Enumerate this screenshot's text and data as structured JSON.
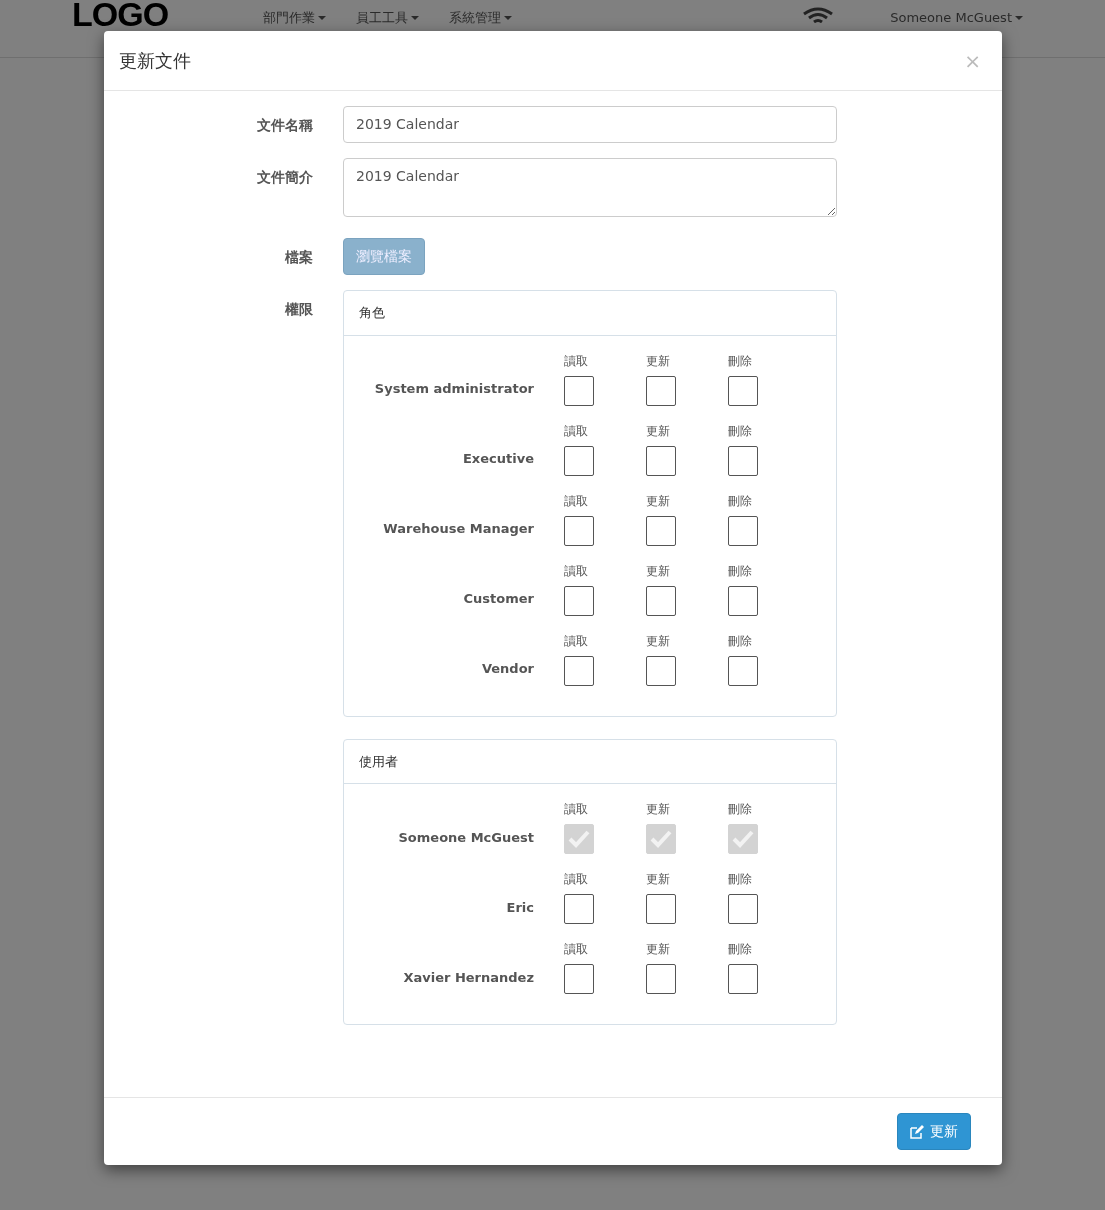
{
  "navbar": {
    "logo": "LOGO",
    "menus": [
      {
        "label": "部門作業"
      },
      {
        "label": "員工工具"
      },
      {
        "label": "系統管理"
      }
    ],
    "user": "Someone McGuest"
  },
  "modal": {
    "title": "更新文件",
    "close": "×",
    "fields": [
      {
        "kind": "input",
        "label": "文件名稱",
        "value": "2019 Calendar"
      },
      {
        "kind": "textarea",
        "label": "文件簡介",
        "value": "2019 Calendar"
      },
      {
        "kind": "file",
        "label": "檔案",
        "button": "瀏覽檔案"
      }
    ],
    "permissions": {
      "label": "權限",
      "panels": [
        {
          "title": "角色",
          "rows": [
            {
              "name": "System administrator",
              "perms": [
                {
                  "label": "讀取",
                  "checked": false,
                  "disabled": false
                },
                {
                  "label": "更新",
                  "checked": false,
                  "disabled": false
                },
                {
                  "label": "刪除",
                  "checked": false,
                  "disabled": false
                }
              ]
            },
            {
              "name": "Executive",
              "perms": [
                {
                  "label": "讀取",
                  "checked": false,
                  "disabled": false
                },
                {
                  "label": "更新",
                  "checked": false,
                  "disabled": false
                },
                {
                  "label": "刪除",
                  "checked": false,
                  "disabled": false
                }
              ]
            },
            {
              "name": "Warehouse Manager",
              "perms": [
                {
                  "label": "讀取",
                  "checked": false,
                  "disabled": false
                },
                {
                  "label": "更新",
                  "checked": false,
                  "disabled": false
                },
                {
                  "label": "刪除",
                  "checked": false,
                  "disabled": false
                }
              ]
            },
            {
              "name": "Customer",
              "perms": [
                {
                  "label": "讀取",
                  "checked": false,
                  "disabled": false
                },
                {
                  "label": "更新",
                  "checked": false,
                  "disabled": false
                },
                {
                  "label": "刪除",
                  "checked": false,
                  "disabled": false
                }
              ]
            },
            {
              "name": "Vendor",
              "perms": [
                {
                  "label": "讀取",
                  "checked": false,
                  "disabled": false
                },
                {
                  "label": "更新",
                  "checked": false,
                  "disabled": false
                },
                {
                  "label": "刪除",
                  "checked": false,
                  "disabled": false
                }
              ]
            }
          ]
        },
        {
          "title": "使用者",
          "rows": [
            {
              "name": "Someone McGuest",
              "perms": [
                {
                  "label": "讀取",
                  "checked": true,
                  "disabled": true
                },
                {
                  "label": "更新",
                  "checked": true,
                  "disabled": true
                },
                {
                  "label": "刪除",
                  "checked": true,
                  "disabled": true
                }
              ]
            },
            {
              "name": "Eric",
              "perms": [
                {
                  "label": "讀取",
                  "checked": false,
                  "disabled": false
                },
                {
                  "label": "更新",
                  "checked": false,
                  "disabled": false
                },
                {
                  "label": "刪除",
                  "checked": false,
                  "disabled": false
                }
              ]
            },
            {
              "name": "Xavier Hernandez",
              "perms": [
                {
                  "label": "讀取",
                  "checked": false,
                  "disabled": false
                },
                {
                  "label": "更新",
                  "checked": false,
                  "disabled": false
                },
                {
                  "label": "刪除",
                  "checked": false,
                  "disabled": false
                }
              ]
            }
          ]
        }
      ]
    },
    "submit": "更新"
  }
}
